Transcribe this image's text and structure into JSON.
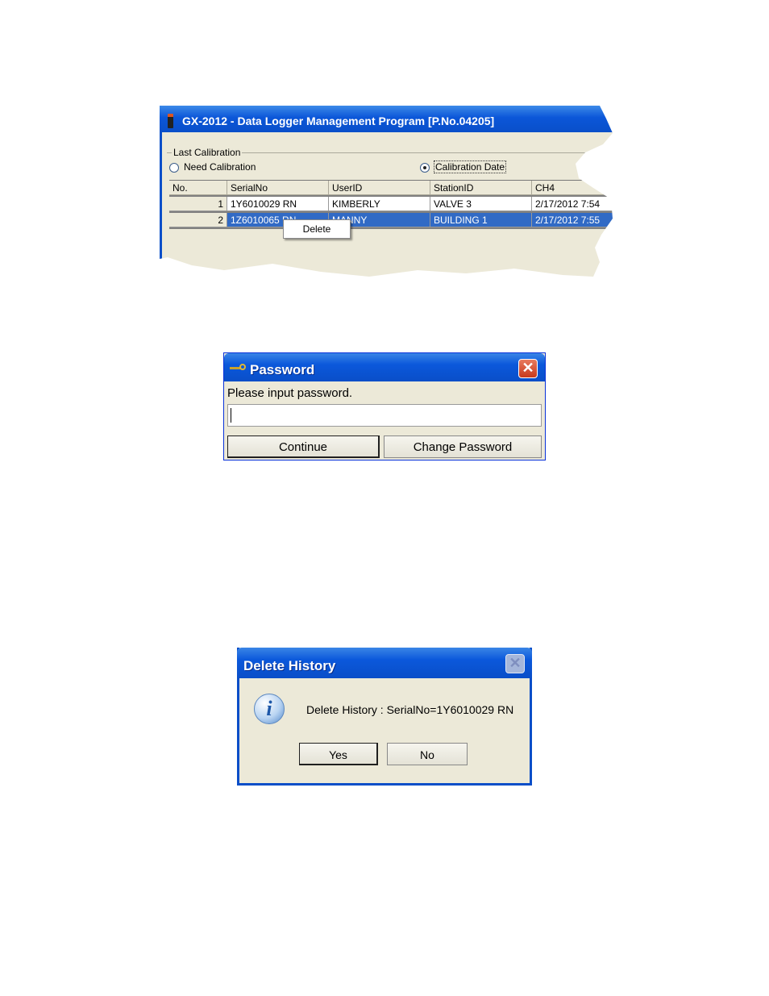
{
  "main_window": {
    "title": "GX-2012  - Data Logger Management Program [P.No.04205]",
    "group_label": "Last Calibration",
    "radio_need": "Need Calibration",
    "radio_calibration_date": "Calibration Date",
    "selected_radio": "Calibration Date",
    "columns": [
      "No.",
      "SerialNo",
      "UserID",
      "StationID",
      "CH4"
    ],
    "rows": [
      {
        "no": "1",
        "serial": "1Y6010029 RN",
        "user": "KIMBERLY",
        "station": "VALVE 3",
        "ch4": "2/17/2012 7:54"
      },
      {
        "no": "2",
        "serial": "1Z6010065 RN",
        "user": "MANNY",
        "station": "BUILDING 1",
        "ch4": "2/17/2012 7:55"
      }
    ],
    "selected_row": 2,
    "context_menu": {
      "delete": "Delete"
    }
  },
  "password_dialog": {
    "title": "Password",
    "prompt": "Please input password.",
    "input_value": "",
    "continue_label": "Continue",
    "change_password_label": "Change Password"
  },
  "delete_dialog": {
    "title": "Delete History",
    "message": "Delete History : SerialNo=1Y6010029 RN",
    "yes_label": "Yes",
    "no_label": "No"
  },
  "colors": {
    "titlebar_blue": "#0b58db",
    "selection_blue": "#316ac5",
    "window_face": "#ece9d8",
    "close_red": "#c7391c"
  }
}
